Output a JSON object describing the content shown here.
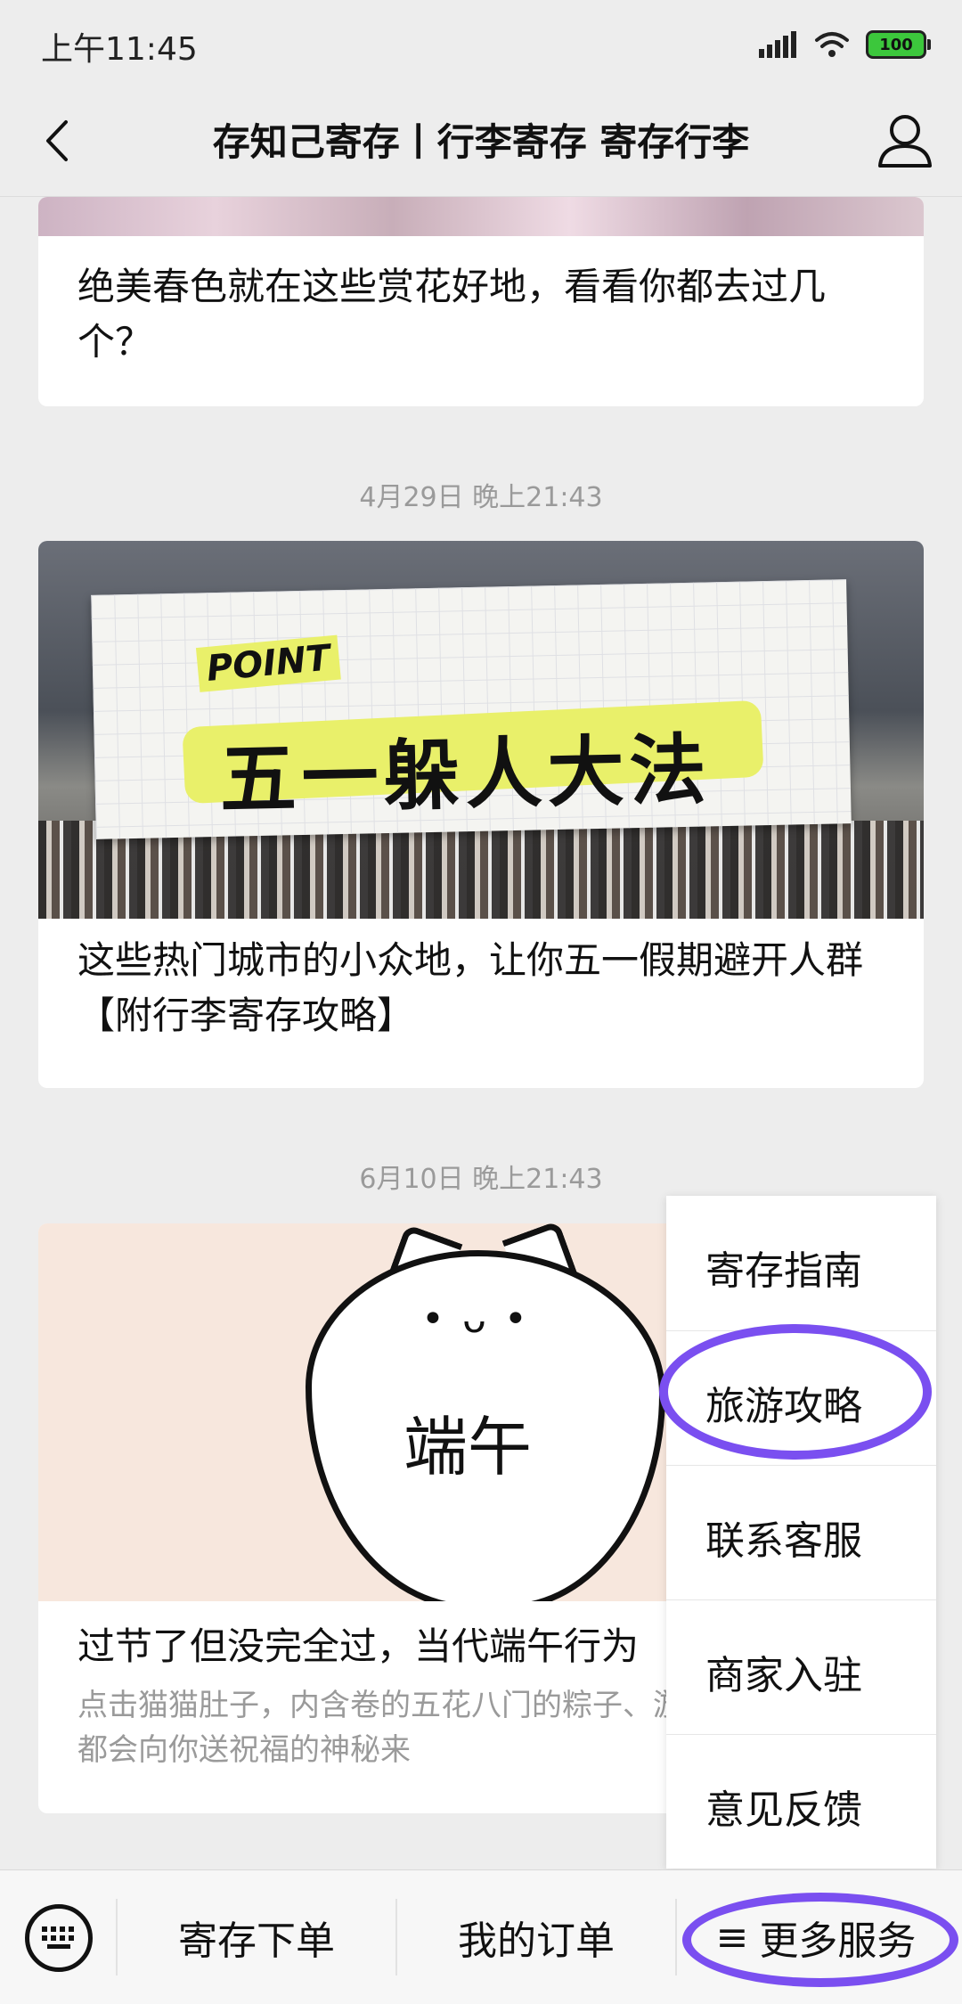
{
  "status_bar": {
    "time": "上午11:45",
    "battery": "100"
  },
  "nav": {
    "title": "存知己寄存丨行李寄存 寄存行李"
  },
  "feed": {
    "posts": [
      {
        "title": "绝美春色就在这些赏花好地，看看你都去过几个？"
      },
      {
        "timestamp": "4月29日 晚上21:43",
        "title": "这些热门城市的小众地，让你五一假期避开人群【附行李寄存攻略】",
        "image_label": "POINT",
        "image_text": "五一躲人大法"
      },
      {
        "timestamp": "6月10日 晚上21:43",
        "title": "过节了但没完全过，当代端午行为",
        "desc": "点击猫猫肚子，内含卷的五花八门的粽子、游法则，和每年都会向你送祝福的神秘来",
        "image_text": "端午"
      }
    ]
  },
  "popup_menu": {
    "items": [
      "寄存指南",
      "旅游攻略",
      "联系客服",
      "商家入驻",
      "意见反馈"
    ]
  },
  "bottom_bar": {
    "items": [
      "寄存下单",
      "我的订单",
      "更多服务"
    ],
    "more_prefix": "≡"
  },
  "annotation_color": "#7a4ff0"
}
